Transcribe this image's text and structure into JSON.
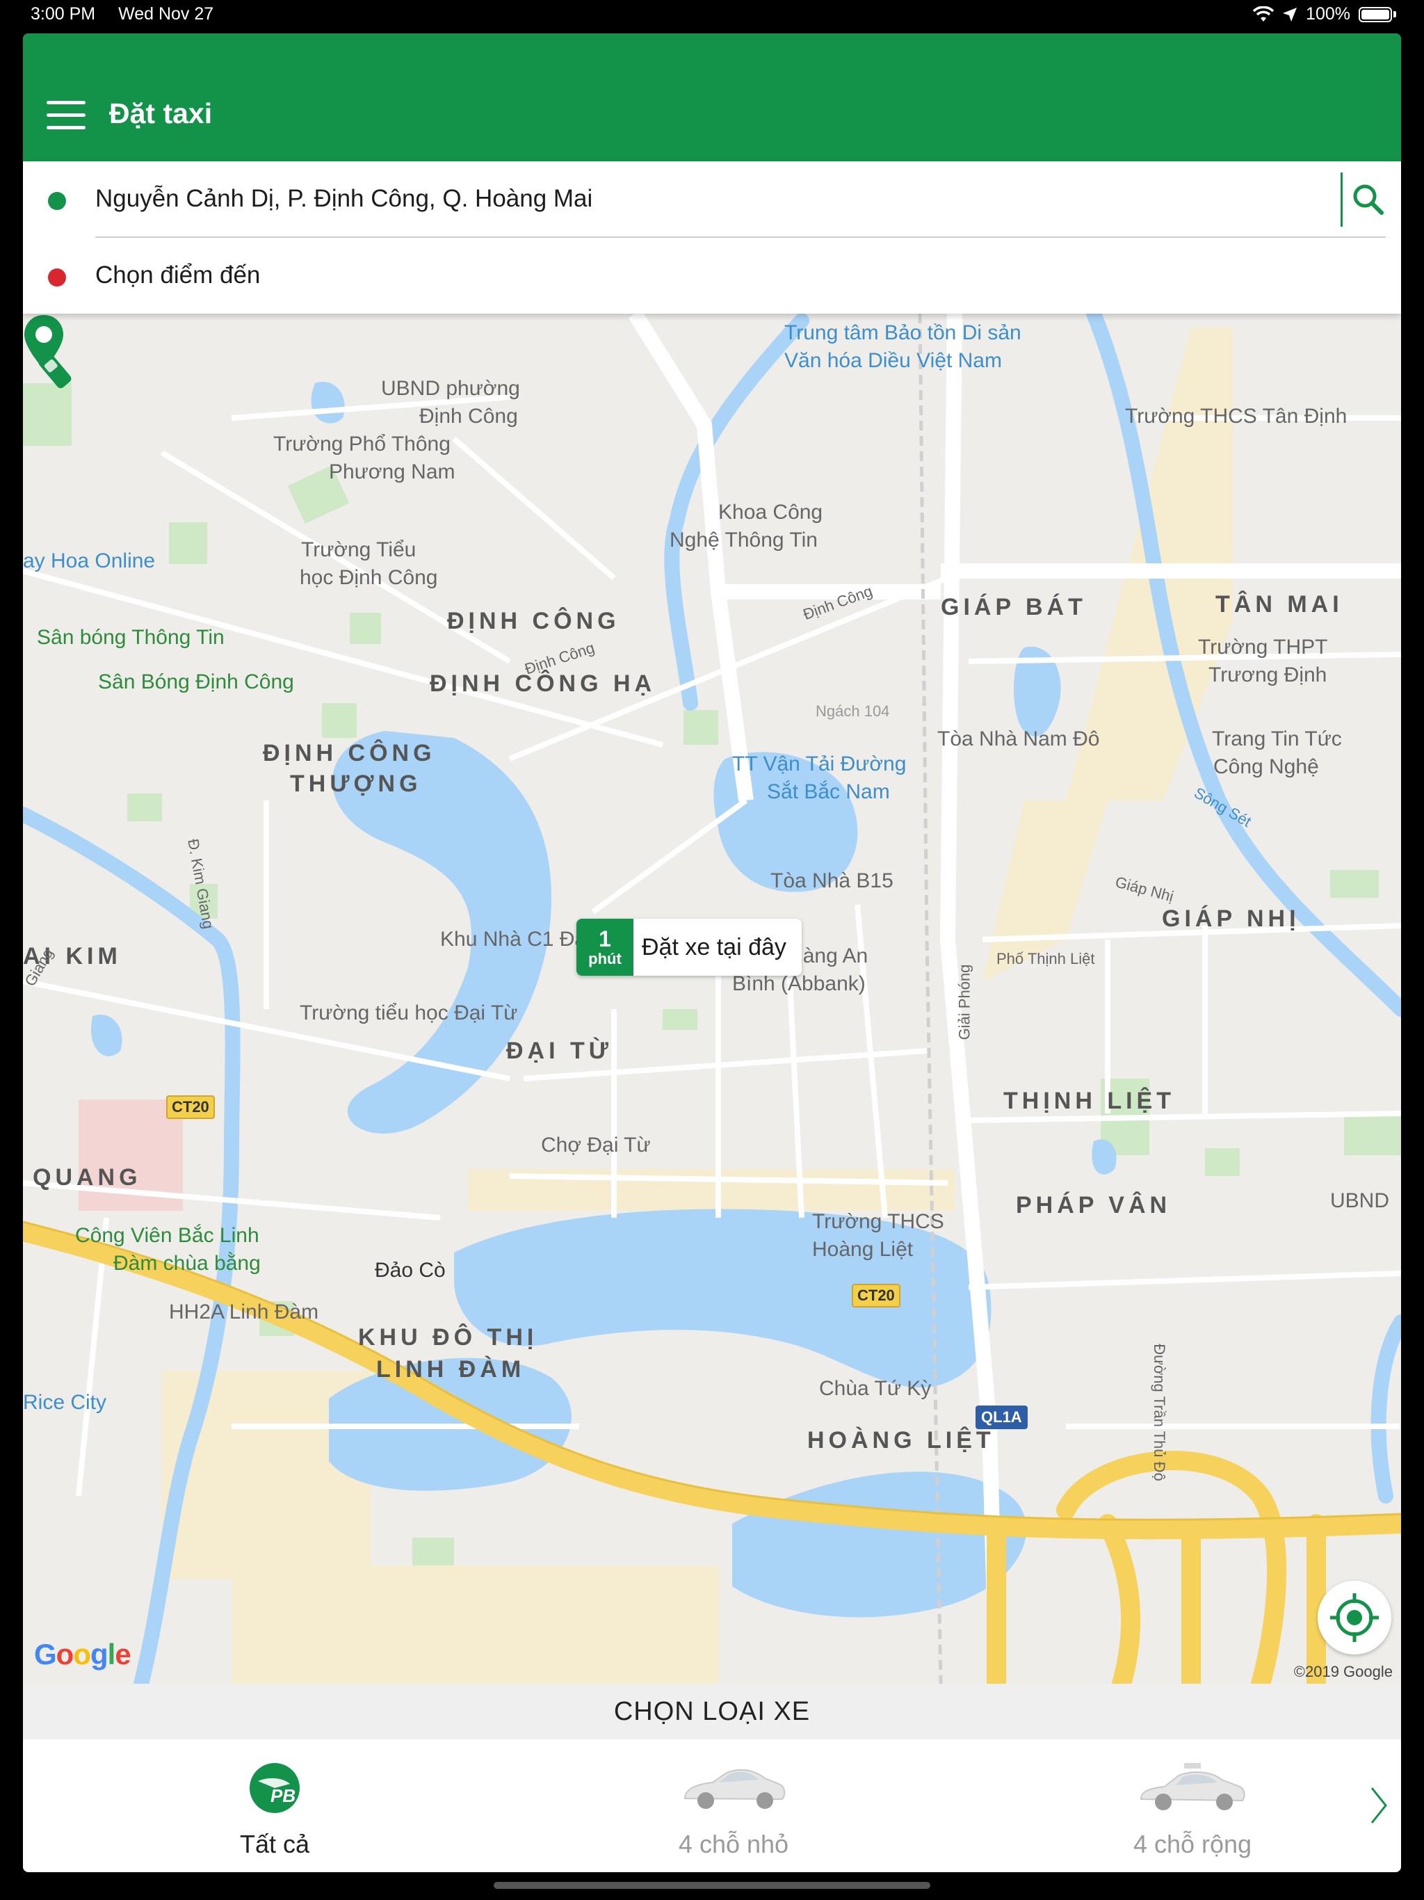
{
  "status_bar": {
    "time": "3:00 PM",
    "date": "Wed Nov 27",
    "battery": "100%"
  },
  "header": {
    "title": "Đặt taxi"
  },
  "address": {
    "pickup": "Nguyễn Cảnh Dị, P. Định Công, Q. Hoàng Mai",
    "destination_placeholder": "Chọn điểm đến"
  },
  "map": {
    "callout": {
      "eta_number": "1",
      "eta_unit": "phút",
      "text": "Đặt xe tại đây"
    },
    "labels": {
      "l1": "Trung tâm Bảo tồn Di sản",
      "l2": "Văn hóa Diều Việt Nam",
      "l3": "UBND phường",
      "l4": "Định Công",
      "l5": "Trường THCS Tân Định",
      "l6": "Trường Phổ Thông",
      "l7": "Phương Nam",
      "l8": "Khoa Công",
      "l9": "Nghệ Thông Tin",
      "l10": "ay Hoa Online",
      "l11": "Trường Tiểu",
      "l12": "học Định Công",
      "l13": "Định Công",
      "l14": "GIÁP BÁT",
      "l15": "TÂN MAI",
      "l16": "Sân bóng Thông Tin",
      "l17": "ĐỊNH CÔNG",
      "l18": "Định Công",
      "l19": "Trường THPT",
      "l20": "Trương Định",
      "l21": "Sân Bóng Định Công",
      "l22": "ĐỊNH CÔNG HẠ",
      "l23": "Ngách 104",
      "l24": "Tòa Nhà Nam Đô",
      "l25": "Trang Tin Tức",
      "l26": "Công Nghệ",
      "l27": "ĐỊNH CÔNG",
      "l28": "THƯỢNG",
      "l29": "TT Vận Tải Đường",
      "l30": "Sắt Bắc Nam",
      "l31": "Sông Sét",
      "l32": "Đ. Kim Giang",
      "l33": "Tòa Nhà B15",
      "l34": "Giáp Nhị",
      "l35": "GIÁP NHỊ",
      "l36": "Khu Nhà C1 Đại Kim",
      "l37": "Giải Phóng",
      "l38": "AI KIM",
      "l39": "Ngân Hàng An",
      "l40": "Bình (Abbank)",
      "l41": "Phố Thịnh Liệt",
      "l42": "Trường tiểu học Đại Từ",
      "l43": "ĐẠI TỪ",
      "l44": "THỊNH LIỆT",
      "l45": "CT20",
      "l46": "Chợ Đại Từ",
      "l47": "QUANG",
      "l48": "PHÁP VÂN",
      "l49": "UBND",
      "l50": "Trường THCS",
      "l51": "Hoàng Liệt",
      "l52": "Công Viên Bắc Linh",
      "l53": "Đàm chùa bằng",
      "l54": "Đảo Cò",
      "l55": "CT20",
      "l56": "HH2A Linh Đàm",
      "l57": "KHU ĐÔ THỊ",
      "l58": "LINH ĐÀM",
      "l59": "Đường Trần Thủ Độ",
      "l60": "Chùa Tứ Kỳ",
      "l61": "Rice City",
      "l62": "QL1A",
      "l63": "HOÀNG LIỆT",
      "l64": "Giang"
    },
    "google": "Google",
    "copyright": "©2019 Google"
  },
  "vehicle": {
    "header": "CHỌN LOẠI XE",
    "items": [
      {
        "label": "Tất cả"
      },
      {
        "label": "4 chỗ nhỏ"
      },
      {
        "label": "4 chỗ rộng"
      }
    ]
  },
  "colors": {
    "brand_green": "#13924a",
    "destination_red": "#d9262f",
    "water": "#a9d3f7"
  }
}
